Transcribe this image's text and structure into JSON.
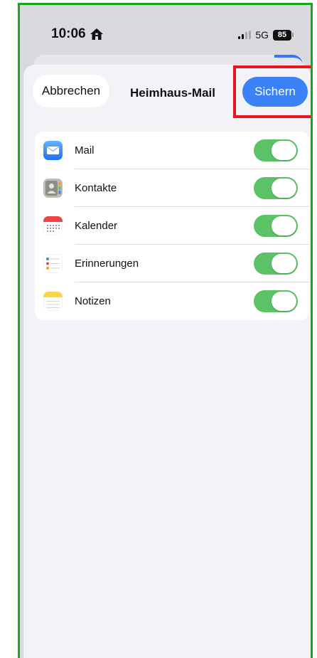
{
  "status_bar": {
    "time": "10:06",
    "network": "5G",
    "battery": "85"
  },
  "nav": {
    "cancel_label": "Abbrechen",
    "title": "Heimhaus-Mail",
    "save_label": "Sichern"
  },
  "services": [
    {
      "label": "Mail",
      "icon": "mail-icon",
      "enabled": true
    },
    {
      "label": "Kontakte",
      "icon": "contacts-icon",
      "enabled": true
    },
    {
      "label": "Kalender",
      "icon": "calendar-icon",
      "enabled": true
    },
    {
      "label": "Erinnerungen",
      "icon": "reminders-icon",
      "enabled": true
    },
    {
      "label": "Notizen",
      "icon": "notes-icon",
      "enabled": true
    }
  ],
  "colors": {
    "accent": "#3b82f6",
    "toggle_on": "#5bc266",
    "highlight": "#e8141e",
    "frame": "#1aa61a"
  }
}
